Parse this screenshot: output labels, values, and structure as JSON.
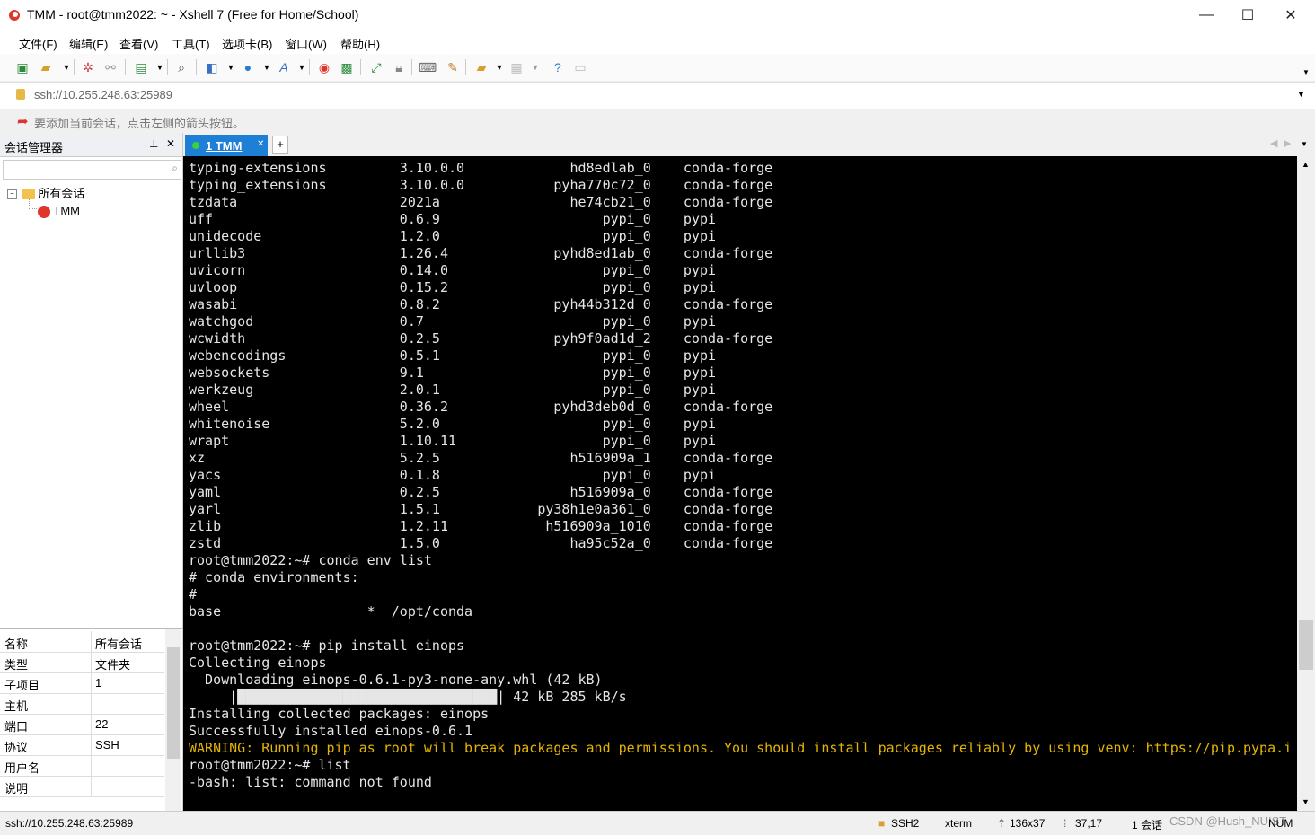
{
  "window": {
    "title": "TMM - root@tmm2022: ~ - Xshell 7 (Free for Home/School)",
    "minimize": "—",
    "maximize": "☐",
    "close": "✕"
  },
  "menu": [
    "文件(F)",
    "编辑(E)",
    "查看(V)",
    "工具(T)",
    "选项卡(B)",
    "窗口(W)",
    "帮助(H)"
  ],
  "address": "ssh://10.255.248.63:25989",
  "info_hint": "要添加当前会话，点击左侧的箭头按钮。",
  "session_manager": {
    "title": "会话管理器",
    "pin": "⊥",
    "close": "✕",
    "tree_root": "所有会话",
    "tree_child": "TMM"
  },
  "properties": [
    {
      "key": "名称",
      "value": "所有会话"
    },
    {
      "key": "类型",
      "value": "文件夹"
    },
    {
      "key": "子项目",
      "value": "1"
    },
    {
      "key": "主机",
      "value": ""
    },
    {
      "key": "端口",
      "value": "22"
    },
    {
      "key": "协议",
      "value": "SSH"
    },
    {
      "key": "用户名",
      "value": ""
    },
    {
      "key": "说明",
      "value": ""
    }
  ],
  "tab": {
    "label": "1 TMM",
    "close": "✕",
    "add": "+"
  },
  "terminal": {
    "lines": [
      "typing-extensions         3.10.0.0             hd8edlab_0    conda-forge",
      "typing_extensions         3.10.0.0           pyha770c72_0    conda-forge",
      "tzdata                    2021a                he74cb21_0    conda-forge",
      "uff                       0.6.9                    pypi_0    pypi",
      "unidecode                 1.2.0                    pypi_0    pypi",
      "urllib3                   1.26.4             pyhd8ed1ab_0    conda-forge",
      "uvicorn                   0.14.0                   pypi_0    pypi",
      "uvloop                    0.15.2                   pypi_0    pypi",
      "wasabi                    0.8.2              pyh44b312d_0    conda-forge",
      "watchgod                  0.7                      pypi_0    pypi",
      "wcwidth                   0.2.5              pyh9f0ad1d_2    conda-forge",
      "webencodings              0.5.1                    pypi_0    pypi",
      "websockets                9.1                      pypi_0    pypi",
      "werkzeug                  2.0.1                    pypi_0    pypi",
      "wheel                     0.36.2             pyhd3deb0d_0    conda-forge",
      "whitenoise                5.2.0                    pypi_0    pypi",
      "wrapt                     1.10.11                  pypi_0    pypi",
      "xz                        5.2.5                h516909a_1    conda-forge",
      "yacs                      0.1.8                    pypi_0    pypi",
      "yaml                      0.2.5                h516909a_0    conda-forge",
      "yarl                      1.5.1            py38h1e0a361_0    conda-forge",
      "zlib                      1.2.11            h516909a_1010    conda-forge",
      "zstd                      1.5.0                ha95c52a_0    conda-forge",
      "root@tmm2022:~# conda env list",
      "# conda environments:",
      "#",
      "base                  *  /opt/conda",
      "",
      "root@tmm2022:~# pip install einops",
      "Collecting einops",
      "  Downloading einops-0.6.1-py3-none-any.whl (42 kB)",
      "     |████████████████████████████████| 42 kB 285 kB/s",
      "Installing collected packages: einops",
      "Successfully installed einops-0.6.1"
    ],
    "warning": "WARNING: Running pip as root will break packages and permissions. You should install packages reliably by using venv: https://pip.pypa.i",
    "tail": [
      "root@tmm2022:~# list",
      "-bash: list: command not found"
    ]
  },
  "status": {
    "address": "ssh://10.255.248.63:25989",
    "protocol": "SSH2",
    "term": "xterm",
    "size": "136x37",
    "cursor": "37,17",
    "sessions": "1 会话",
    "numlock": "NUM"
  },
  "watermark": "CSDN @Hush_NUIST",
  "colors": {
    "accent": "#1e7fd6",
    "warning": "#e3b400",
    "terminal_bg": "#000000"
  }
}
